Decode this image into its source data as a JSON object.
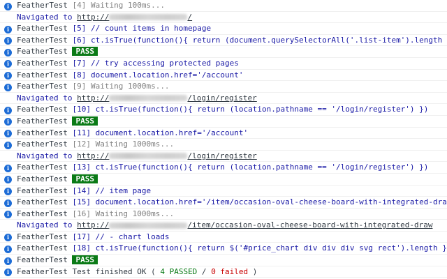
{
  "console": {
    "prefix": "FeatherTest",
    "url_base": "http://",
    "rows": {
      "r0": {
        "text": "[4] Waiting 100ms..."
      },
      "r1": {
        "label": "Navigated to",
        "url_scheme": "http://",
        "url_path": "/"
      },
      "r2": {
        "text": "[5] // count items in homepage"
      },
      "r3": {
        "text": "[6] ct.isTrue(function(){ return (document.querySelectorAll('.list-item').length"
      },
      "r4": {
        "badge": "PASS"
      },
      "r5": {
        "text": "[7] // try accessing protected pages"
      },
      "r6": {
        "text": "[8] document.location.href='/account'"
      },
      "r7": {
        "text": "[9] Waiting 1000ms..."
      },
      "r8": {
        "label": "Navigated to",
        "url_scheme": "http://",
        "url_path": "/login/register"
      },
      "r9": {
        "text": "[10] ct.isTrue(function(){ return (location.pathname == '/login/register') })"
      },
      "r10": {
        "badge": "PASS"
      },
      "r11": {
        "text": "[11] document.location.href='/account'"
      },
      "r12": {
        "text": "[12] Waiting 1000ms..."
      },
      "r13": {
        "label": "Navigated to",
        "url_scheme": "http://",
        "url_path": "/login/register"
      },
      "r14": {
        "text": "[13] ct.isTrue(function(){ return (location.pathname == '/login/register') })"
      },
      "r15": {
        "badge": "PASS"
      },
      "r16": {
        "text": "[14] // item page"
      },
      "r17": {
        "text": "[15] document.location.href='/item/occasion-oval-cheese-board-with-integrated-dra"
      },
      "r18": {
        "text": "[16] Waiting 1000ms..."
      },
      "r19": {
        "label": "Navigated to",
        "url_scheme": "http://",
        "url_path": "/item/occasion-oval-cheese-board-with-integrated-draw"
      },
      "r20": {
        "text": "[17] // - chart loads"
      },
      "r21": {
        "text": "[18] ct.isTrue(function(){ return $('#price_chart div div div svg rect').length }"
      },
      "r22": {
        "badge": "PASS"
      },
      "r23": {
        "text_before": "Test finished OK ( ",
        "passed": "4 PASSED",
        "separator": " / ",
        "failed": "0 failed",
        "text_after": " )"
      }
    },
    "prompt_symbol": "›"
  },
  "colors": {
    "info_icon": "#1d6cd6",
    "message_blue": "#1a1aa6",
    "message_gray": "#808080",
    "pass_badge": "#0a7a16",
    "failed": "#c80000"
  },
  "icons": {
    "info": "info-circle-icon",
    "prompt": "chevron-right-icon"
  }
}
